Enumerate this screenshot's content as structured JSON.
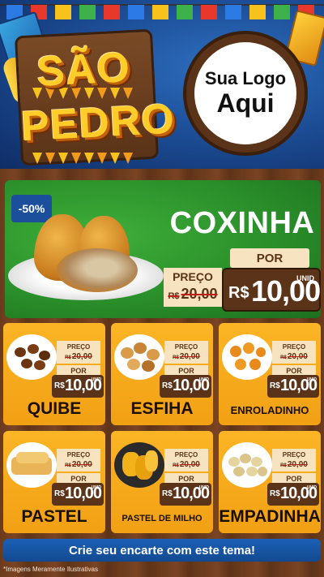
{
  "header": {
    "title_line1": "SÃO",
    "title_line2": "PEDRO",
    "logo_line1": "Sua Logo",
    "logo_line2": "Aqui"
  },
  "featured": {
    "discount": "-50%",
    "name": "COXINHA",
    "price_label": "PREÇO",
    "old_currency": "R$",
    "old_price": "20,00",
    "por_label": "POR",
    "new_currency": "R$",
    "new_price": "10,00",
    "unit": "UNID"
  },
  "products": [
    {
      "name": "QUIBE",
      "price_label": "PREÇO",
      "old_currency": "R$",
      "old_price": "20,00",
      "por_label": "POR",
      "new_currency": "R$",
      "new_price": "10,00",
      "unit": "UNID"
    },
    {
      "name": "ESFIHA",
      "price_label": "PREÇO",
      "old_currency": "R$",
      "old_price": "20,00",
      "por_label": "POR",
      "new_currency": "R$",
      "new_price": "10,00",
      "unit": "UNID"
    },
    {
      "name": "ENROLADINHO",
      "price_label": "PREÇO",
      "old_currency": "R$",
      "old_price": "20,00",
      "por_label": "POR",
      "new_currency": "R$",
      "new_price": "10,00",
      "unit": "UNID"
    },
    {
      "name": "PASTEL",
      "price_label": "PREÇO",
      "old_currency": "R$",
      "old_price": "20,00",
      "por_label": "POR",
      "new_currency": "R$",
      "new_price": "10,00",
      "unit": "UNID"
    },
    {
      "name": "PASTEL DE MILHO",
      "price_label": "PREÇO",
      "old_currency": "R$",
      "old_price": "20,00",
      "por_label": "POR",
      "new_currency": "R$",
      "new_price": "10,00",
      "unit": "UNID"
    },
    {
      "name": "EMPADINHA",
      "price_label": "PREÇO",
      "old_currency": "R$",
      "old_price": "20,00",
      "por_label": "POR",
      "new_currency": "R$",
      "new_price": "10,00",
      "unit": "UNID"
    }
  ],
  "footer": {
    "cta": "Crie seu encarte com este tema!",
    "disclaimer": "*Imagens Meramente Ilustrativas"
  },
  "colors": {
    "sky": "#1d4f98",
    "featured_green": "#2a8f2a",
    "card_orange": "#f2a014",
    "price_dark": "#5a3318",
    "cta_blue": "#1b5fb5"
  }
}
